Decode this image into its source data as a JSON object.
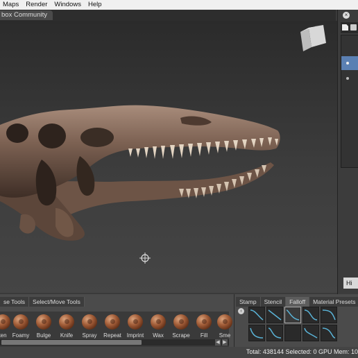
{
  "menu": [
    "Maps",
    "Render",
    "Windows",
    "Help"
  ],
  "viewport_tab": "box Community",
  "right_panel": {
    "help_button": "Hi"
  },
  "left_tabs": [
    "se Tools",
    "Select/Move Tools"
  ],
  "brushes": [
    {
      "label": "ten"
    },
    {
      "label": "Foamy"
    },
    {
      "label": "Bulge"
    },
    {
      "label": "Knife"
    },
    {
      "label": "Spray"
    },
    {
      "label": "Repeat"
    },
    {
      "label": "Imprint"
    },
    {
      "label": "Wax"
    },
    {
      "label": "Scrape"
    },
    {
      "label": "Fill"
    },
    {
      "label": "Sme"
    }
  ],
  "right_tabs": [
    "Stamp",
    "Stencil",
    "Falloff",
    "Material Presets"
  ],
  "active_right_tab": "Falloff",
  "status": "Total: 438144   Selected: 0 GPU Mem: 10",
  "colors": {
    "accent": "#5b80b3",
    "skull": "#7a5e4f"
  }
}
